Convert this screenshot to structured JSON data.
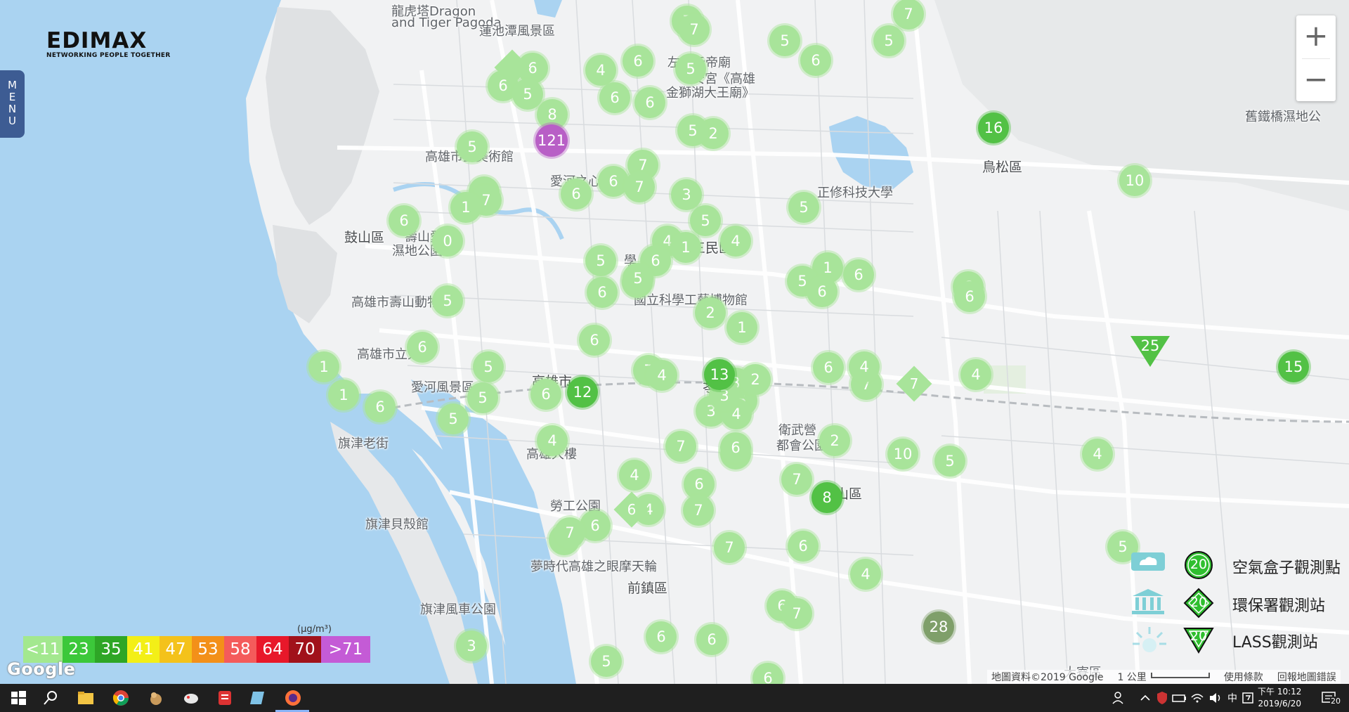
{
  "app": {
    "logo_brand": "EDIMAX",
    "logo_tagline": "NETWORKING PEOPLE TOGETHER",
    "menu_label": "MENU"
  },
  "zoom": {
    "in": "+",
    "out": "−"
  },
  "map_labels": [
    {
      "text": "龍虎塔Dragon",
      "cls": "",
      "id": "label-dragon-tiger-1"
    },
    {
      "text": "and Tiger Pagoda",
      "cls": "",
      "id": "label-dragon-tiger-2"
    },
    {
      "text": "蓮池潭風景區",
      "cls": "",
      "id": "label-lotus-pond"
    },
    {
      "text": "左營元帝廟",
      "cls": "",
      "id": "label-temple-1"
    },
    {
      "text": "安宮《高雄",
      "cls": "",
      "id": "label-temple-2"
    },
    {
      "text": "金獅湖大王廟》",
      "cls": "",
      "id": "label-temple-3"
    },
    {
      "text": "高雄市立美術館",
      "cls": "",
      "id": "label-art-museum"
    },
    {
      "text": "愛河之心",
      "cls": "",
      "id": "label-love-river-heart"
    },
    {
      "text": "正修科技大學",
      "cls": "",
      "id": "label-cheng-shiu"
    },
    {
      "text": "鳥松區",
      "cls": "big",
      "id": "label-niaosong"
    },
    {
      "text": "鼓山區",
      "cls": "big",
      "id": "label-gushan"
    },
    {
      "text": "壽山愛",
      "cls": "",
      "id": "label-shoushan-1"
    },
    {
      "text": "濕地公園",
      "cls": "",
      "id": "label-shoushan-2"
    },
    {
      "text": "三民區",
      "cls": "big",
      "id": "label-sanmin"
    },
    {
      "text": "學",
      "cls": "",
      "id": "label-school"
    },
    {
      "text": "高雄市壽山動物園",
      "cls": "",
      "id": "label-zoo"
    },
    {
      "text": "國立科學工藝博物館",
      "cls": "",
      "id": "label-science-museum"
    },
    {
      "text": "高雄市立大學",
      "cls": "",
      "id": "label-university"
    },
    {
      "text": "愛河風景區",
      "cls": "",
      "id": "label-love-river"
    },
    {
      "text": "高雄市",
      "cls": "big",
      "id": "label-kaohsiung"
    },
    {
      "text": "苓雅區",
      "cls": "big",
      "id": "label-lingya"
    },
    {
      "text": "旗津老街",
      "cls": "",
      "id": "label-cijin-street"
    },
    {
      "text": "高雄大樓",
      "cls": "",
      "id": "label-tower"
    },
    {
      "text": "衛武營",
      "cls": "",
      "id": "label-weiwuying-1"
    },
    {
      "text": "都會公園",
      "cls": "",
      "id": "label-weiwuying-2"
    },
    {
      "text": "鳳山區",
      "cls": "big",
      "id": "label-fengshan"
    },
    {
      "text": "勞工公園",
      "cls": "",
      "id": "label-labor-park"
    },
    {
      "text": "旗津貝殼館",
      "cls": "",
      "id": "label-shell-museum"
    },
    {
      "text": "夢時代高雄之眼摩天輪",
      "cls": "",
      "id": "label-dream-mall"
    },
    {
      "text": "前鎮區",
      "cls": "big",
      "id": "label-qianzhen"
    },
    {
      "text": "旗津風車公園",
      "cls": "",
      "id": "label-windmill-park"
    },
    {
      "text": "舊鐵橋濕地公",
      "cls": "",
      "id": "label-old-bridge"
    },
    {
      "text": "大寮區",
      "cls": "",
      "id": "label-daliao"
    }
  ],
  "markers": [
    {
      "v": "7"
    },
    {
      "v": "7"
    },
    {
      "v": "7"
    },
    {
      "v": "5"
    },
    {
      "v": "5"
    },
    {
      "v": "6"
    },
    {
      "v": "6"
    },
    {
      "v": "5"
    },
    {
      "v": "4"
    },
    {
      "v": "6"
    },
    {
      "v": "6"
    },
    {
      "v": "8"
    },
    {
      "v": "6"
    },
    {
      "v": "6"
    },
    {
      "v": "5"
    },
    {
      "v": "2"
    },
    {
      "v": "121",
      "c": "purple"
    },
    {
      "v": "16",
      "c": "green"
    },
    {
      "v": "5"
    },
    {
      "v": "7"
    },
    {
      "v": "6"
    },
    {
      "v": "7"
    },
    {
      "v": "7"
    },
    {
      "v": "6"
    },
    {
      "v": "7"
    },
    {
      "v": "3"
    },
    {
      "v": "1"
    },
    {
      "v": "6"
    },
    {
      "v": "0"
    },
    {
      "v": "5"
    },
    {
      "v": "5"
    },
    {
      "v": "5"
    },
    {
      "v": "4"
    },
    {
      "v": "1"
    },
    {
      "v": "4"
    },
    {
      "v": "10"
    },
    {
      "v": "6"
    },
    {
      "v": "5"
    },
    {
      "v": "6"
    },
    {
      "v": "6"
    },
    {
      "v": "5"
    },
    {
      "v": "6"
    },
    {
      "v": "1"
    },
    {
      "v": "6"
    },
    {
      "v": "5"
    },
    {
      "v": "5"
    },
    {
      "v": "6"
    },
    {
      "v": "2"
    },
    {
      "v": "1"
    },
    {
      "v": "6"
    },
    {
      "v": "6"
    },
    {
      "v": "5"
    },
    {
      "v": "7"
    },
    {
      "v": "6"
    },
    {
      "v": "5"
    },
    {
      "v": "4"
    },
    {
      "v": "7"
    },
    {
      "v": "3"
    },
    {
      "v": "2"
    },
    {
      "v": "6"
    },
    {
      "v": "4"
    },
    {
      "v": "1"
    },
    {
      "v": "4"
    },
    {
      "v": "15",
      "c": "green"
    },
    {
      "v": "1"
    },
    {
      "v": "6"
    },
    {
      "v": "12",
      "c": "green"
    },
    {
      "v": "5"
    },
    {
      "v": "5"
    },
    {
      "v": "6"
    },
    {
      "v": "3"
    },
    {
      "v": "4"
    },
    {
      "v": "3"
    },
    {
      "v": "13",
      "c": "green"
    },
    {
      "v": "4"
    },
    {
      "v": "6"
    },
    {
      "v": "7"
    },
    {
      "v": "2"
    },
    {
      "v": "4"
    },
    {
      "v": "6"
    },
    {
      "v": "10"
    },
    {
      "v": "5"
    },
    {
      "v": "4"
    },
    {
      "v": "7"
    },
    {
      "v": "8",
      "c": "green"
    },
    {
      "v": "4"
    },
    {
      "v": "4"
    },
    {
      "v": "6"
    },
    {
      "v": "7"
    },
    {
      "v": "7"
    },
    {
      "v": "6"
    },
    {
      "v": "5"
    },
    {
      "v": "4"
    },
    {
      "v": "6"
    },
    {
      "v": "7"
    },
    {
      "v": "28",
      "c": "olive"
    },
    {
      "v": "6"
    },
    {
      "v": "6"
    },
    {
      "v": "3"
    },
    {
      "v": "5"
    },
    {
      "v": "6"
    },
    {
      "v": "6"
    },
    {
      "v": "7"
    }
  ],
  "diamonds": [
    {
      "v": "7"
    },
    {
      "v": "6"
    },
    {
      "v": ""
    }
  ],
  "triangles": [
    {
      "v": "25"
    }
  ],
  "pm_legend": {
    "unit": "(μg/m³)",
    "cells": [
      {
        "label": "<11",
        "color": "#a3e88f"
      },
      {
        "label": "23",
        "color": "#3cc83a"
      },
      {
        "label": "35",
        "color": "#2ea626"
      },
      {
        "label": "41",
        "color": "#f3ef17"
      },
      {
        "label": "47",
        "color": "#f4c21b"
      },
      {
        "label": "53",
        "color": "#f39019"
      },
      {
        "label": "58",
        "color": "#f45b5b"
      },
      {
        "label": "64",
        "color": "#e8182a"
      },
      {
        "label": "70",
        "color": "#a1121b"
      },
      {
        "label": ">71",
        "color": "#c45bd6"
      }
    ]
  },
  "type_legend": [
    {
      "value": "20",
      "label": "空氣盒子觀測點",
      "icon": "cloud-box-icon"
    },
    {
      "value": "20",
      "label": "環保署觀測站",
      "icon": "government-building-icon"
    },
    {
      "value": "20",
      "label": "LASS觀測站",
      "icon": "sun-icon"
    }
  ],
  "google": {
    "logo": "Google",
    "data": "地圖資料©2019 Google",
    "scale": "1 公里",
    "terms": "使用條款",
    "report": "回報地圖錯誤"
  },
  "taskbar": {
    "time": "下午 10:12",
    "date": "2019/6/20",
    "ime": "中",
    "notify_count": "20"
  },
  "colors": {
    "marker_light": "#a8e49a",
    "marker_green": "#52c145",
    "marker_purple": "#b85fc6",
    "menu_blue": "#3d5c93",
    "sea": "#aadaff"
  }
}
